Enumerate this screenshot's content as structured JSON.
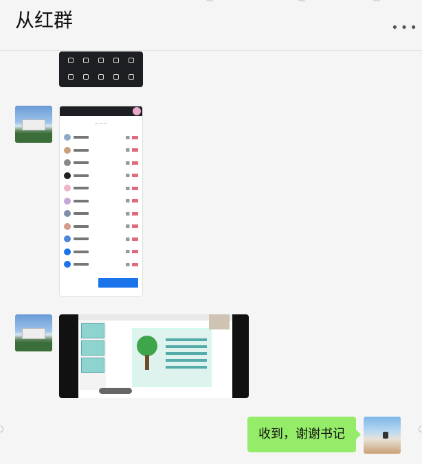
{
  "header": {
    "title": "从红群",
    "more_icon": "more-dots-icon"
  },
  "messages": [
    {
      "type": "image",
      "from": "other",
      "content": "screenshot-meeting-controls"
    },
    {
      "type": "image",
      "from": "other",
      "content": "screenshot-participant-list"
    },
    {
      "type": "image",
      "from": "other",
      "content": "screenshot-presentation"
    },
    {
      "type": "text",
      "from": "self",
      "text": "收到，谢谢书记"
    }
  ],
  "colors": {
    "self_bubble": "#95ec69",
    "background": "#f5f5f5"
  }
}
